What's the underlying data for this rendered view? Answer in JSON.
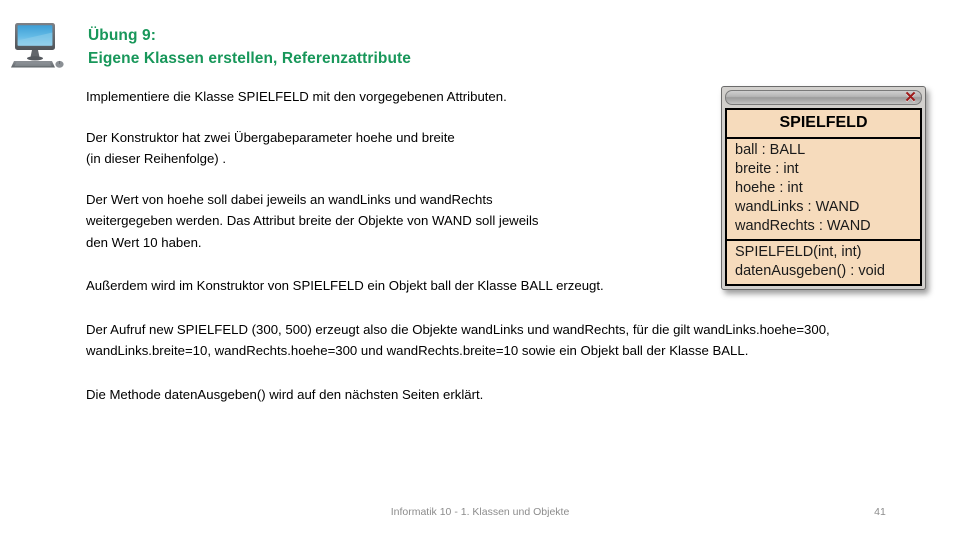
{
  "slide": {
    "icon_name": "desktop-computer-icon",
    "accent_color": "#18975A",
    "title_line1": "Übung 9:",
    "title_line2": "Eigene Klassen erstellen, Referenzattribute",
    "paragraphs": [
      "Implementiere die Klasse SPIELFELD mit den vorgegebenen Attributen.",
      "Der Konstruktor hat zwei Übergabeparameter hoehe und breite\n(in dieser Reihenfolge) .",
      "Der Wert von hoehe soll dabei jeweils an wandLinks und wandRechts\nweitergegeben werden. Das Attribut breite der Objekte von WAND soll jeweils\nden Wert 10 haben.",
      "Außerdem wird im Konstruktor von SPIELFELD ein Objekt ball der Klasse BALL erzeugt.",
      "Der Aufruf new SPIELFELD (300, 500) erzeugt also die Objekte wandLinks und wandRechts, für die gilt wandLinks.hoehe=300, wandLinks.breite=10, wandRechts.hoehe=300 und wandRechts.breite=10 sowie ein Objekt ball der Klasse BALL.",
      "Die Methode datenAusgeben() wird auf den nächsten Seiten erklärt."
    ]
  },
  "uml_window": {
    "close_label": "✕",
    "close_color": "#9e1b1b",
    "box_background": "#F6DBBC",
    "class_name": "SPIELFELD",
    "attributes": [
      "ball : BALL",
      "breite : int",
      "hoehe : int",
      "wandLinks : WAND",
      "wandRechts : WAND"
    ],
    "methods": [
      "SPIELFELD(int, int)",
      "datenAusgeben() : void"
    ]
  },
  "footer": {
    "text": "Informatik 10 - 1. Klassen und Objekte",
    "page_number": "41"
  }
}
